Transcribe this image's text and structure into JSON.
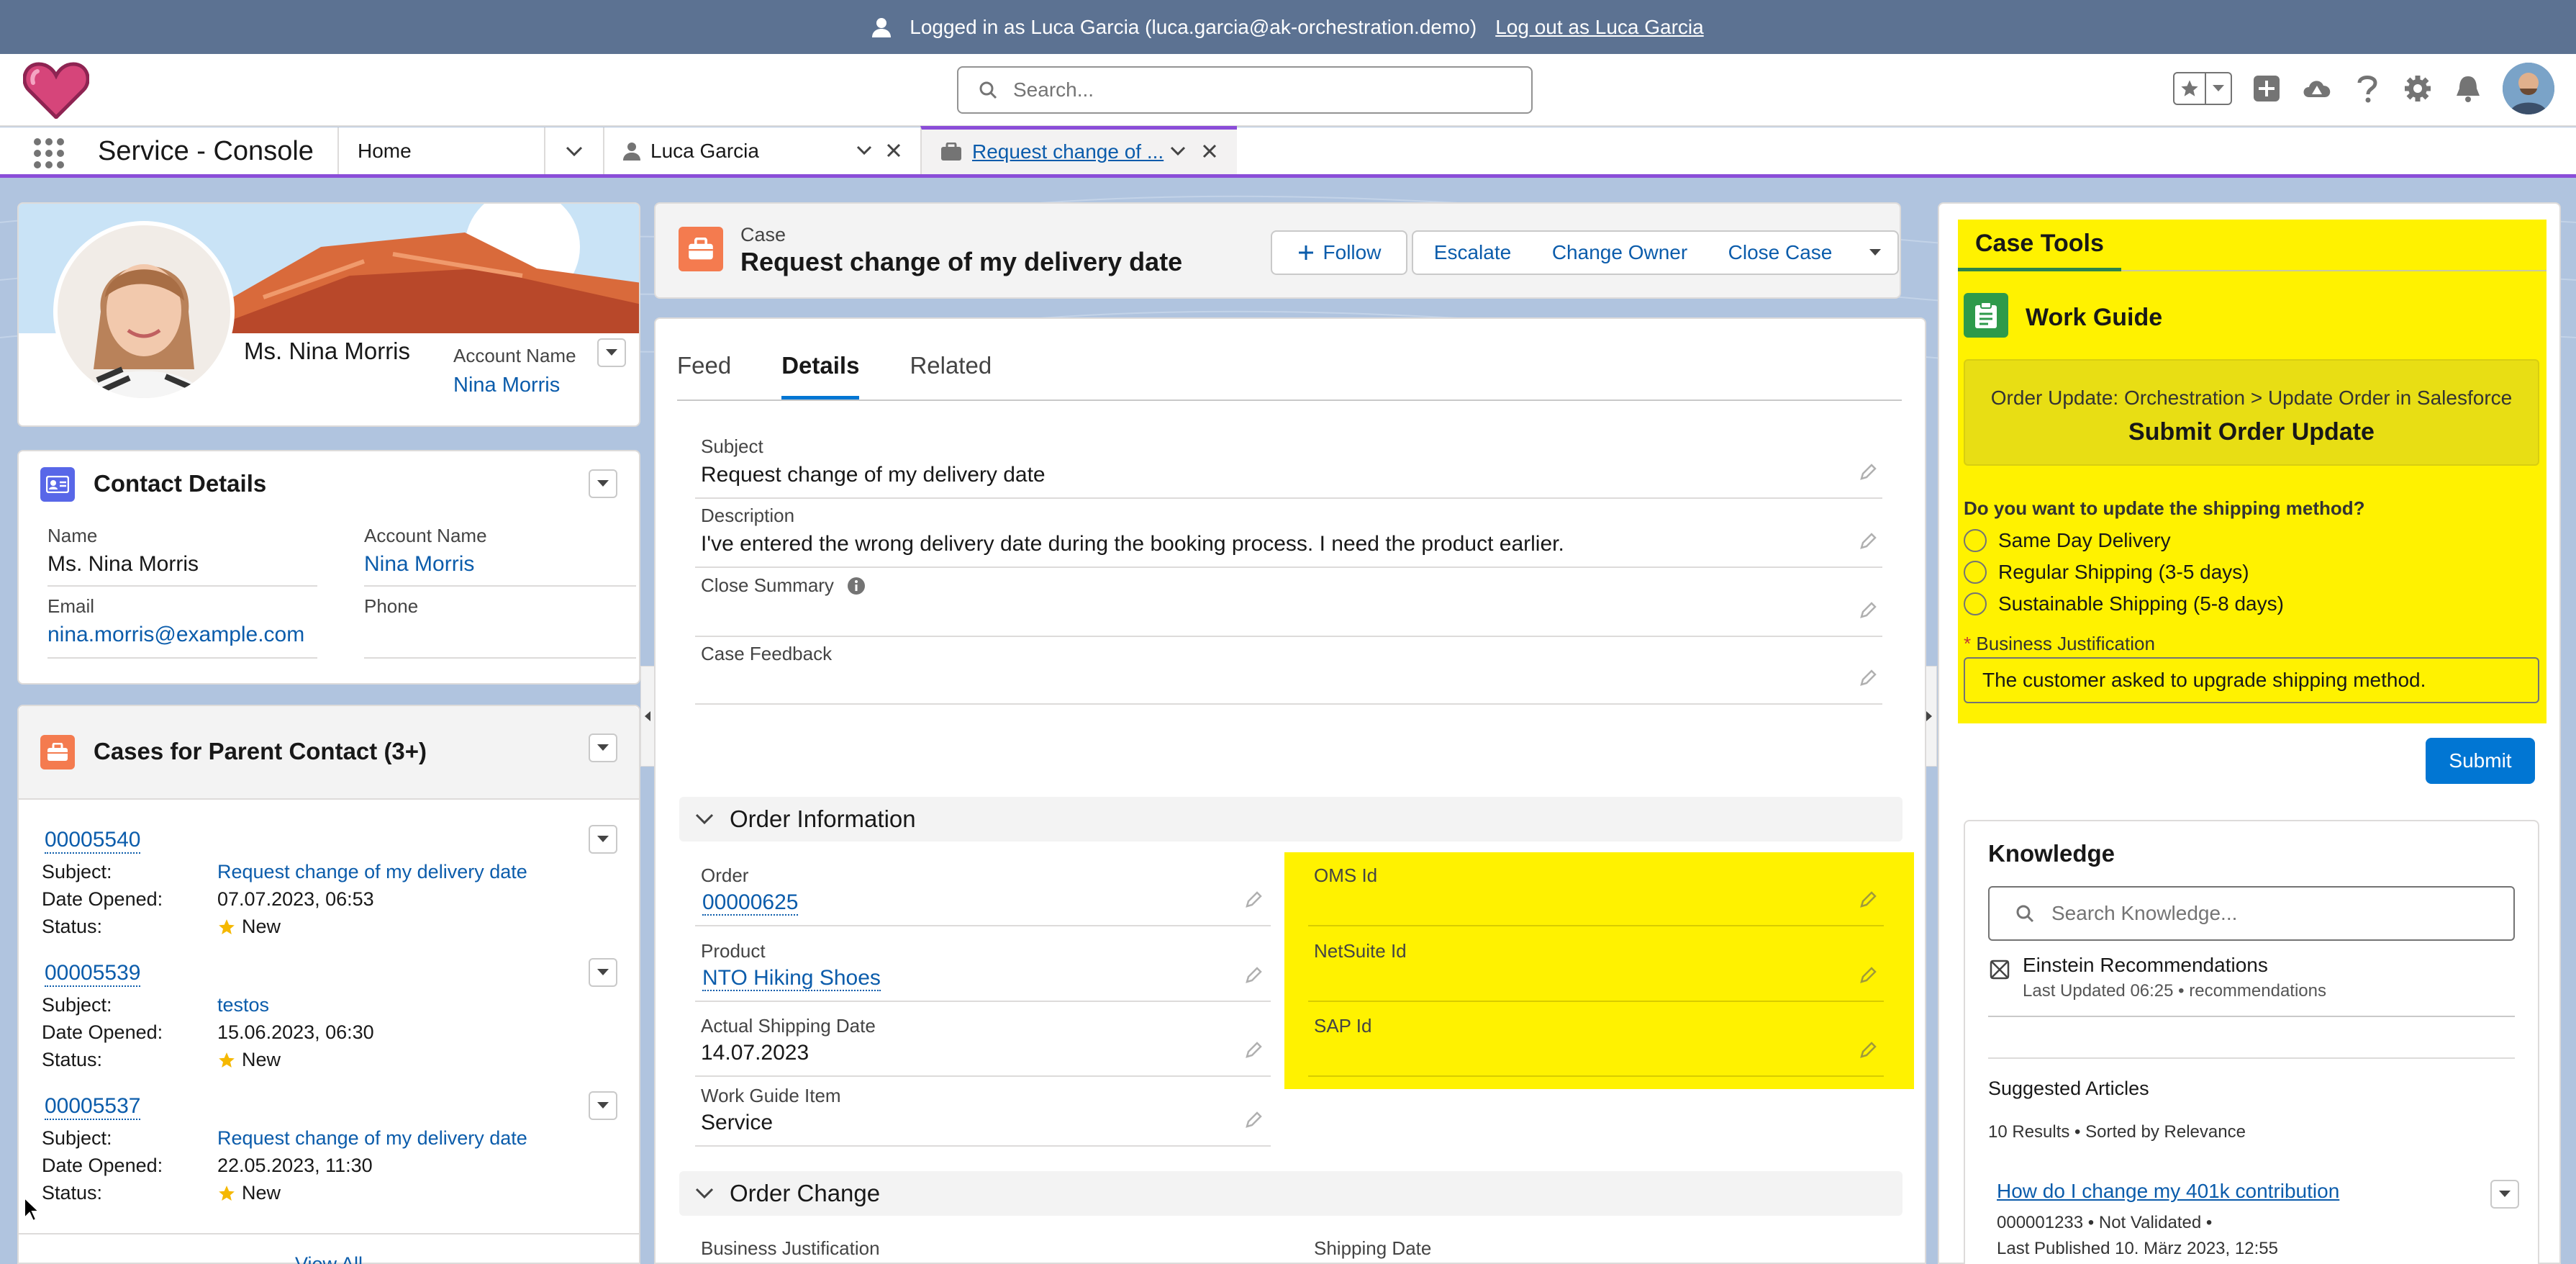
{
  "banner": {
    "logged_in": "Logged in as Luca Garcia (luca.garcia@ak-orchestration.demo)",
    "logout": "Log out as Luca Garcia"
  },
  "header": {
    "search_placeholder": "Search..."
  },
  "nav": {
    "app_name": "Service - Console",
    "tabs": [
      {
        "label": "Home"
      },
      {
        "label": "Luca Garcia"
      },
      {
        "label": "Request change of ..."
      }
    ]
  },
  "profile": {
    "name": "Ms. Nina Morris",
    "account_label": "Account Name",
    "account_value": "Nina Morris"
  },
  "contact_details": {
    "title": "Contact Details",
    "name_label": "Name",
    "name_value": "Ms. Nina Morris",
    "account_label": "Account Name",
    "account_value": "Nina Morris",
    "email_label": "Email",
    "email_value": "nina.morris@example.com",
    "phone_label": "Phone",
    "phone_value": ""
  },
  "cases_related": {
    "title": "Cases for Parent Contact (3+)",
    "subject_label": "Subject:",
    "date_label": "Date Opened:",
    "status_label": "Status:",
    "items": [
      {
        "number": "00005540",
        "subject": "Request change of my delivery date",
        "date": "07.07.2023, 06:53",
        "status": "New"
      },
      {
        "number": "00005539",
        "subject": "testos",
        "date": "15.06.2023, 06:30",
        "status": "New"
      },
      {
        "number": "00005537",
        "subject": "Request change of my delivery date",
        "date": "22.05.2023, 11:30",
        "status": "New"
      }
    ],
    "view_all": "View All"
  },
  "case_header": {
    "object": "Case",
    "title": "Request change of my delivery date",
    "follow": "Follow",
    "escalate": "Escalate",
    "change_owner": "Change Owner",
    "close_case": "Close Case"
  },
  "detail_tabs": {
    "feed": "Feed",
    "details": "Details",
    "related": "Related"
  },
  "details": {
    "subject_label": "Subject",
    "subject_value": "Request change of my delivery date",
    "description_label": "Description",
    "description_value": "I've entered the wrong delivery date during the booking process. I need the product earlier.",
    "close_summary_label": "Close Summary",
    "case_feedback_label": "Case Feedback"
  },
  "order_info": {
    "title": "Order Information",
    "order_label": "Order",
    "order_value": "00000625",
    "product_label": "Product",
    "product_value": "NTO Hiking Shoes",
    "ship_date_label": "Actual Shipping Date",
    "ship_date_value": "14.07.2023",
    "wg_item_label": "Work Guide Item",
    "wg_item_value": "Service",
    "oms_label": "OMS Id",
    "netsuite_label": "NetSuite Id",
    "sap_label": "SAP Id"
  },
  "order_change": {
    "title": "Order Change",
    "business_justification_label": "Business Justification",
    "shipping_date_label": "Shipping Date"
  },
  "case_tools": {
    "tab": "Case Tools",
    "work_guide": "Work Guide",
    "step_path": "Order Update: Orchestration > Update Order in Salesforce",
    "step_title": "Submit Order Update",
    "question": "Do you want to update the shipping method?",
    "options": [
      "Same Day Delivery",
      "Regular Shipping (3-5 days)",
      "Sustainable Shipping (5-8 days)"
    ],
    "required_mark": "*",
    "justification_label": "Business Justification",
    "justification_value": "The customer asked to upgrade shipping method.",
    "submit": "Submit"
  },
  "knowledge": {
    "title": "Knowledge",
    "search_placeholder": "Search Knowledge...",
    "einstein_title": "Einstein Recommendations",
    "einstein_meta": "Last Updated 06:25 • recommendations",
    "suggested": "Suggested Articles",
    "results": "10 Results • Sorted by Relevance",
    "article_title": "How do I change my 401k contribution",
    "article_meta": "000001233  •  Not Validated  •",
    "article_published": "Last Published  10. März 2023, 12:55"
  },
  "colors": {
    "brand_blue": "#0176d3",
    "link": "#0b5cab",
    "highlight": "#fff200",
    "case_orange": "#f47b4f",
    "banner": "#5c7292",
    "tab_accent": "#8a4dd8"
  }
}
